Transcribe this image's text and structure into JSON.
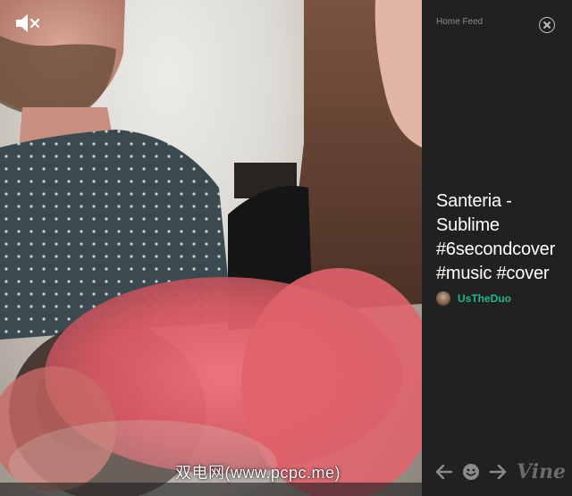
{
  "video": {
    "watermark": "双电网(www.pcpc.me)",
    "mute_icon": "speaker-muted-icon"
  },
  "panel": {
    "feed_label": "Home Feed",
    "close_icon": "close-icon",
    "caption_lines": [
      "Santeria -",
      "Sublime",
      "#6secondcover",
      "#music #cover"
    ],
    "author": {
      "name": "UsTheDuo",
      "color": "#1db88c"
    },
    "controls": {
      "prev_icon": "arrow-left-icon",
      "smile_icon": "smiley-icon",
      "next_icon": "arrow-right-icon",
      "logo": "Vine"
    }
  },
  "colors": {
    "panel_bg": "#212121",
    "accent": "#1db88c"
  }
}
